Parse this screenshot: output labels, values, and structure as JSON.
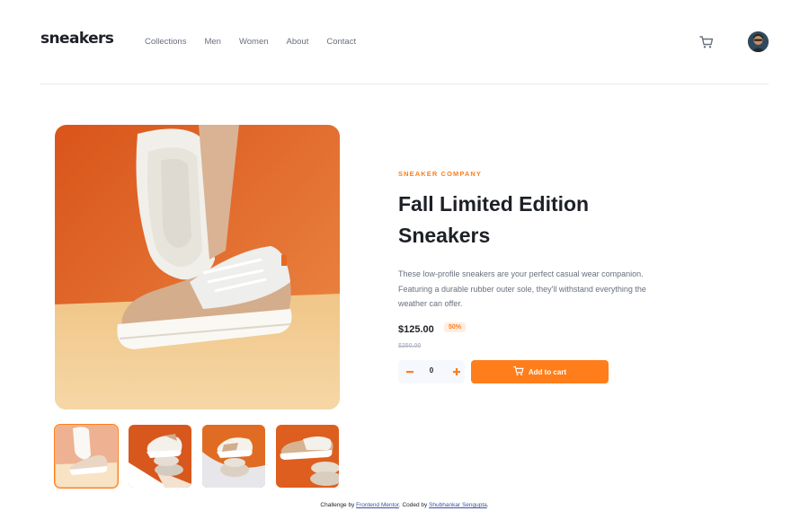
{
  "header": {
    "logo": "sneakers",
    "nav": [
      "Collections",
      "Men",
      "Women",
      "About",
      "Contact"
    ],
    "cart_icon": "cart-icon",
    "avatar_icon": "avatar"
  },
  "product": {
    "company": "SNEAKER COMPANY",
    "title": "Fall Limited Edition Sneakers",
    "description": "These low-profile sneakers are your perfect casual wear companion. Featuring a durable rubber outer sole, they'll withstand everything the weather can offer.",
    "price": "$125.00",
    "discount": "50%",
    "old_price": "$250.00",
    "quantity": "0",
    "add_to_cart": "Add to cart",
    "thumbnails": [
      "thumbnail-1",
      "thumbnail-2",
      "thumbnail-3",
      "thumbnail-4"
    ],
    "active_thumbnail": 1
  },
  "footer": {
    "prefix": "Challenge by ",
    "link1": "Frontend Mentor",
    "middle": ". Coded by ",
    "link2": "Shubhankar Sengupta",
    "suffix": "."
  },
  "colors": {
    "accent": "#ff7e1b",
    "accent_pale": "#ffede0",
    "text_dark": "#1d2026",
    "text_grey": "#69707d",
    "footer_link": "#3e52a3"
  }
}
